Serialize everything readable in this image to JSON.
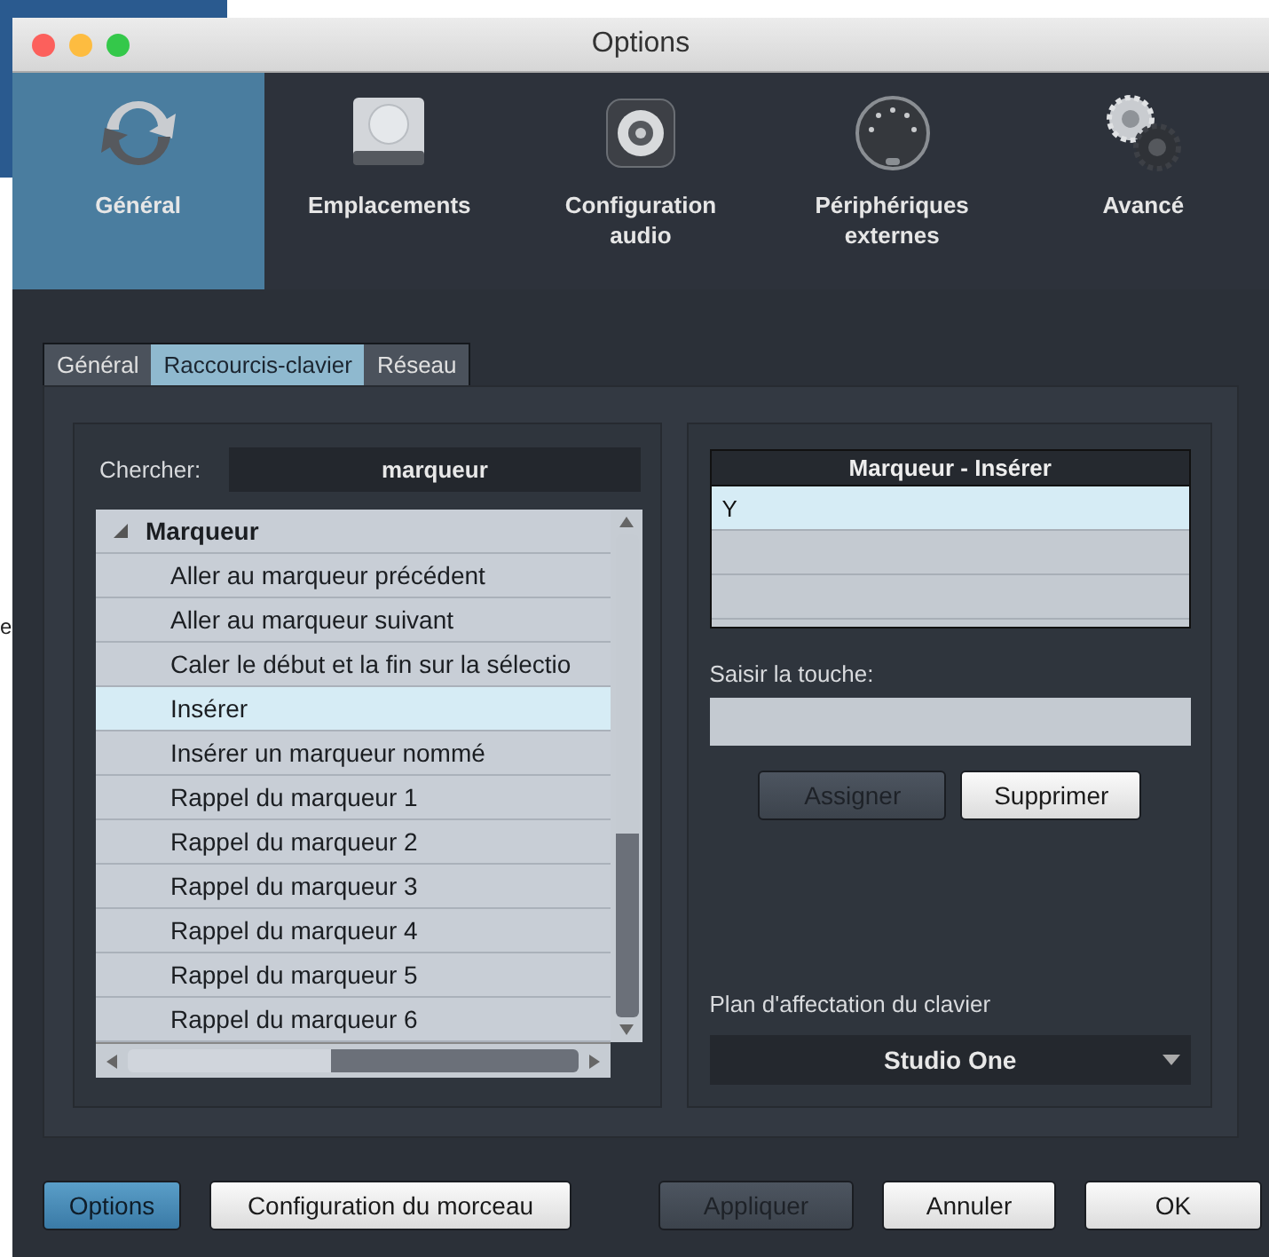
{
  "background": {
    "fragment": "e"
  },
  "window": {
    "title": "Options"
  },
  "categories": [
    {
      "label": "Général",
      "kind": "sync",
      "selected": true
    },
    {
      "label": "Emplacements",
      "kind": "drive",
      "selected": false
    },
    {
      "label": "Configuration audio",
      "kind": "speaker",
      "selected": false
    },
    {
      "label": "Périphériques externes",
      "kind": "midi",
      "selected": false
    },
    {
      "label": "Avancé",
      "kind": "gears",
      "selected": false
    }
  ],
  "tabs": [
    {
      "label": "Général",
      "selected": false
    },
    {
      "label": "Raccourcis-clavier",
      "selected": true
    },
    {
      "label": "Réseau",
      "selected": false
    }
  ],
  "search": {
    "label": "Chercher:",
    "value": "marqueur"
  },
  "tree": [
    {
      "label": "Marqueur",
      "expanded": true,
      "children": [
        {
          "label": "Aller au marqueur précédent",
          "selected": false
        },
        {
          "label": "Aller au marqueur suivant",
          "selected": false
        },
        {
          "label": "Caler le début et la fin sur la sélectio",
          "selected": false
        },
        {
          "label": "Insérer",
          "selected": true
        },
        {
          "label": "Insérer un marqueur nommé",
          "selected": false
        },
        {
          "label": "Rappel du marqueur 1",
          "selected": false
        },
        {
          "label": "Rappel du marqueur 2",
          "selected": false
        },
        {
          "label": "Rappel du marqueur 3",
          "selected": false
        },
        {
          "label": "Rappel du marqueur 4",
          "selected": false
        },
        {
          "label": "Rappel du marqueur 5",
          "selected": false
        },
        {
          "label": "Rappel du marqueur 6",
          "selected": false
        }
      ]
    }
  ],
  "shortcuts": {
    "header": "Marqueur - Insérer",
    "rows": [
      {
        "key": "Y",
        "selected": true
      },
      {
        "key": null,
        "selected": false
      },
      {
        "key": null,
        "selected": false
      }
    ]
  },
  "key_input": {
    "label": "Saisir la touche:"
  },
  "shortcut_buttons": [
    {
      "label": "Assigner",
      "disabled": true
    },
    {
      "label": "Supprimer",
      "disabled": false
    }
  ],
  "keymap": {
    "label": "Plan d'affectation du clavier",
    "value": "Studio One"
  },
  "footer_left": [
    {
      "label": "Options",
      "selected": true
    },
    {
      "label": "Configuration du morceau",
      "selected": false
    }
  ],
  "footer_right": [
    {
      "label": "Appliquer",
      "disabled": true
    },
    {
      "label": "Annuler",
      "disabled": false
    },
    {
      "label": "OK",
      "disabled": false
    }
  ]
}
